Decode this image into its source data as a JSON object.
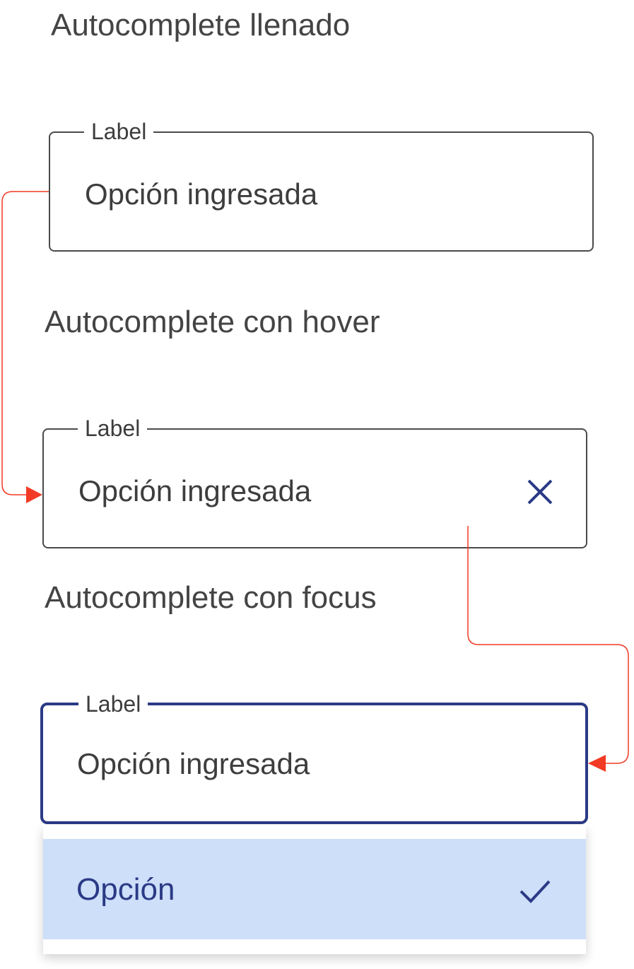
{
  "sections": [
    {
      "title": "Autocomplete llenado",
      "field": {
        "label": "Label",
        "value": "Opción ingresada"
      }
    },
    {
      "title": "Autocomplete con hover",
      "field": {
        "label": "Label",
        "value": "Opción ingresada",
        "clear_icon": "close-icon"
      }
    },
    {
      "title": "Autocomplete con focus",
      "field": {
        "label": "Label",
        "value": "Opción ingresada"
      },
      "dropdown": {
        "options": [
          {
            "label": "Opción",
            "selected": true,
            "icon": "check-icon"
          }
        ]
      }
    }
  ],
  "colors": {
    "focus_border": "#2b3a86",
    "selected_option_bg": "#cddff9",
    "connector": "#f23a24",
    "default_border": "#4a4a4a"
  }
}
